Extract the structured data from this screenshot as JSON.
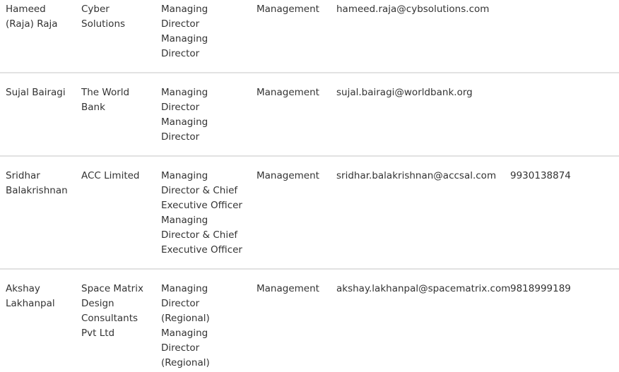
{
  "rows": [
    {
      "name": [
        "Hameed",
        "(Raja) Raja"
      ],
      "company": [
        "Cyber",
        "Solutions"
      ],
      "title": [
        "Managing",
        "Director",
        "Managing",
        "Director"
      ],
      "department": "Management",
      "email": "hameed.raja@cybsolutions.com",
      "phone": ""
    },
    {
      "name": [
        "Sujal Bairagi"
      ],
      "company": [
        "The World",
        "Bank"
      ],
      "title": [
        "Managing",
        "Director",
        "Managing",
        "Director"
      ],
      "department": "Management",
      "email": "sujal.bairagi@worldbank.org",
      "phone": ""
    },
    {
      "name": [
        "Sridhar",
        "Balakrishnan"
      ],
      "company": [
        "ACC Limited"
      ],
      "title": [
        "Managing",
        "Director & Chief",
        "Executive Officer",
        "Managing",
        "Director & Chief",
        "Executive Officer"
      ],
      "department": "Management",
      "email": "sridhar.balakrishnan@accsal.com",
      "phone": "9930138874"
    },
    {
      "name": [
        "Akshay",
        "Lakhanpal"
      ],
      "company": [
        "Space Matrix",
        "Design",
        "Consultants",
        "Pvt Ltd"
      ],
      "title": [
        "Managing",
        "Director",
        "(Regional)",
        "Managing",
        "Director",
        "(Regional)"
      ],
      "department": "Management",
      "email": "akshay.lakhanpal@spacematrix.com",
      "phone": "9818999189"
    }
  ]
}
